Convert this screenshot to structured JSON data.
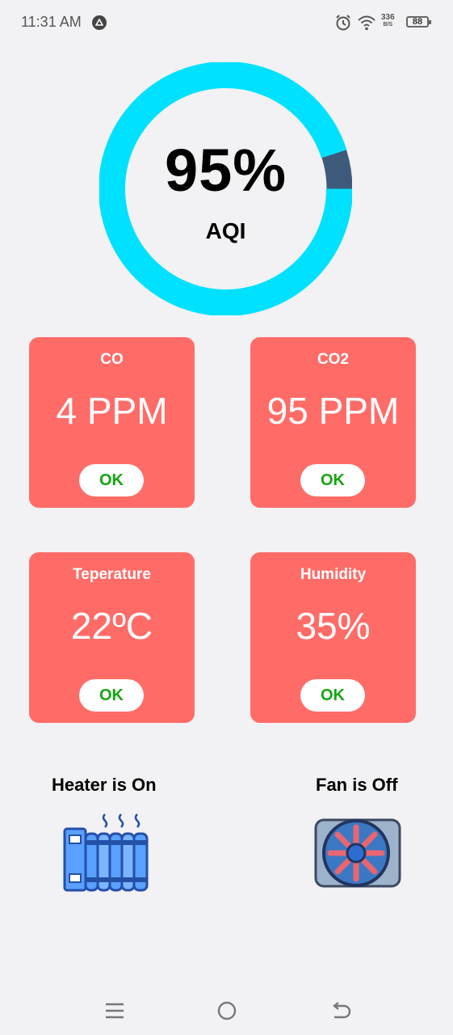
{
  "status_bar": {
    "time": "11:31 AM",
    "net_speed_value": "336",
    "net_speed_unit": "B/S",
    "battery_level": "88"
  },
  "aqi": {
    "value_text": "95%",
    "label": "AQI",
    "percent": 95,
    "ring_color": "#00e1ff",
    "remainder_color": "#3d5a7a"
  },
  "cards": [
    {
      "title": "CO",
      "value": "4 PPM",
      "status": "OK"
    },
    {
      "title": "CO2",
      "value": "95 PPM",
      "status": "OK"
    },
    {
      "title": "Teperature",
      "value": "22ºC",
      "status": "OK"
    },
    {
      "title": "Humidity",
      "value": "35%",
      "status": "OK"
    }
  ],
  "colors": {
    "card_bg": "#ff6c68",
    "ok_text": "#17a512",
    "background": "#f2f1f3"
  },
  "devices": {
    "heater_label": "Heater is On",
    "heater_icon": "heater-icon",
    "fan_label": "Fan is Off",
    "fan_icon": "fan-icon"
  },
  "navigation": {
    "menu_icon": "menu-icon",
    "home_icon": "home-icon",
    "back_icon": "back-icon"
  }
}
